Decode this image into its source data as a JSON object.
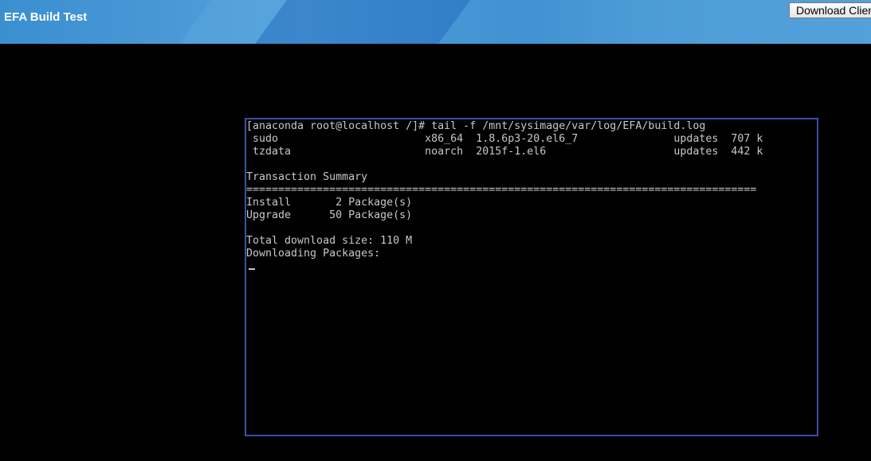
{
  "header": {
    "title": "EFA Build Test",
    "download_button_label": "Download Client"
  },
  "console": {
    "lines": [
      "[anaconda root@localhost /]# tail -f /mnt/sysimage/var/log/EFA/build.log",
      " sudo                       x86_64  1.8.6p3-20.el6_7               updates  707 k",
      " tzdata                     noarch  2015f-1.el6                    updates  442 k",
      "",
      "Transaction Summary",
      "================================================================================",
      "Install       2 Package(s)",
      "Upgrade      50 Package(s)",
      "",
      "Total download size: 110 M",
      "Downloading Packages:"
    ]
  },
  "colors": {
    "header_blue": "#3a8fd0",
    "console_border": "#3b4fa8",
    "console_text": "#c8c8c8",
    "background": "#000000"
  }
}
